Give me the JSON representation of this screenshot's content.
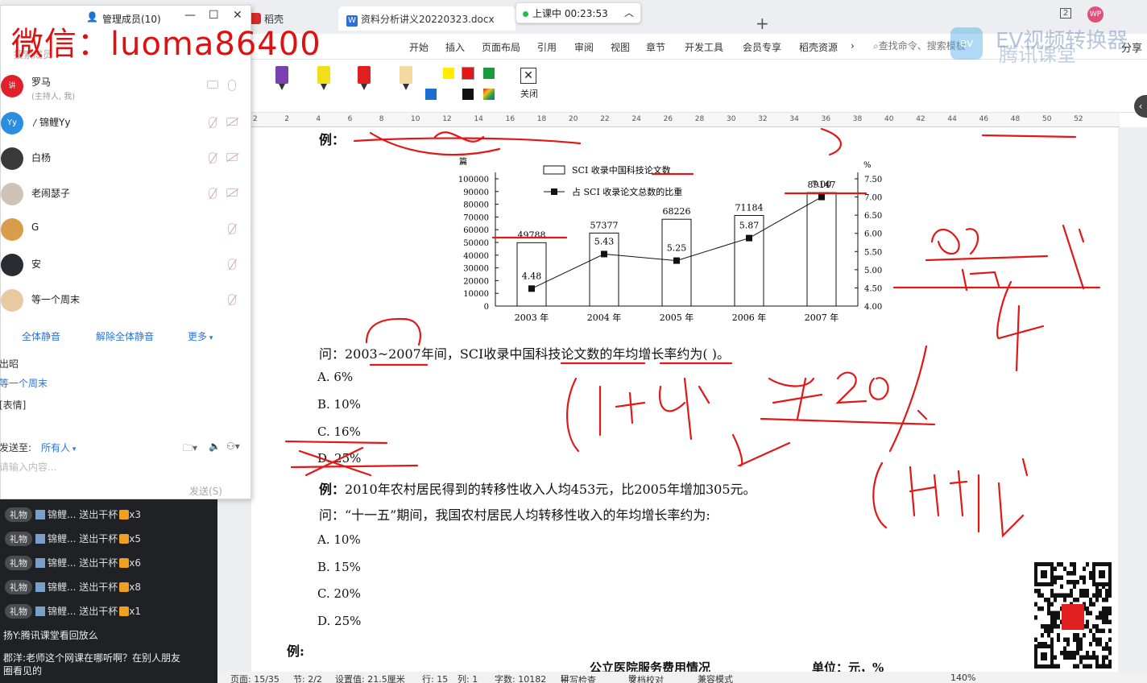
{
  "wps": {
    "tabs": [
      {
        "label": "稻壳"
      },
      {
        "label": "资料分析讲义20220323.docx"
      }
    ],
    "menu": [
      "开始",
      "插入",
      "页面布局",
      "引用",
      "审阅",
      "视图",
      "章节",
      "开发工具",
      "会员专享",
      "稻壳资源"
    ],
    "search_placeholder": "查找命令、搜索模板",
    "share_label": "分享",
    "window_badge": "2",
    "user_initials": "WP",
    "pen_close_label": "关闭",
    "colors": {
      "pens": [
        "#7a3fb0",
        "#f2df1c",
        "#e02020",
        "#f5d9a0"
      ],
      "swatches": [
        "#ffee00",
        "#e01818",
        "#1a9a3a",
        "#1a6fd0",
        "#111111",
        "#c04cc8"
      ]
    },
    "ruler_numbers": [
      "2",
      "2",
      "4",
      "6",
      "8",
      "10",
      "12",
      "14",
      "16",
      "18",
      "20",
      "22",
      "24",
      "26",
      "28",
      "30",
      "32",
      "34",
      "36",
      "38",
      "40",
      "42",
      "44",
      "46",
      "48",
      "50",
      "52"
    ]
  },
  "class_timer": {
    "label": "上课中 00:23:53"
  },
  "member_panel": {
    "title": "管理成员(10)",
    "search_placeholder": "搜索成员",
    "members": [
      {
        "name": "罗马",
        "sub": "(主持人, 我)"
      },
      {
        "name": "锦鲤Yy",
        "sub": ""
      },
      {
        "name": "白杨",
        "sub": ""
      },
      {
        "name": "老闹瑟子",
        "sub": ""
      },
      {
        "name": "G",
        "sub": ""
      },
      {
        "name": "安",
        "sub": ""
      },
      {
        "name": "等一个周末",
        "sub": ""
      }
    ],
    "avatar_texts": {
      "m0": "讲",
      "m1": "Yy"
    },
    "btn_mute_all": "全体静音",
    "btn_unmute_all": "解除全体静音",
    "btn_more": "更多",
    "behind": {
      "line1": "出昭",
      "line2": "等一个周末",
      "line3": "[表情]",
      "send_to_label": "发送至:",
      "send_to_value": "所有人",
      "input_placeholder": "请输入内容...",
      "send_button": "发送(S)"
    }
  },
  "chat": {
    "gift_label": "礼物",
    "gifts": [
      {
        "text": "锦鲤... 送出干杯",
        "count": "x3"
      },
      {
        "text": "锦鲤... 送出干杯",
        "count": "x5"
      },
      {
        "text": "锦鲤... 送出干杯",
        "count": "x6"
      },
      {
        "text": "锦鲤... 送出干杯",
        "count": "x8"
      },
      {
        "text": "锦鲤... 送出干杯",
        "count": "x1"
      }
    ],
    "messages": [
      "扬Y:腾讯课堂看回放么",
      "郡洋:老师这个网课在哪听啊？在别人朋友",
      "圈看见的"
    ]
  },
  "doc": {
    "ex_label": "例：",
    "q1": "问：2003~2007年间，SCI收录中国科技论文数的年均增长率约为(    )。",
    "q1_options": [
      "A. 6%",
      "B. 10%",
      "C. 16%",
      "D. 25%"
    ],
    "ex2": "2010年农村居民得到的转移性收入人均453元，比2005年增加305元。",
    "q2": "问：“十一五”期间，我国农村居民人均转移性收入的年均增长率约为:",
    "q2_options": [
      "A.  10%",
      "B.  15%",
      "C.  20%",
      "D.  25%"
    ],
    "ex3_label": "例:",
    "next_title": "公立医院服务费用情况",
    "next_unit": "单位：元，%"
  },
  "chart_data": {
    "type": "bar",
    "left_axis_unit": "篇",
    "right_axis_unit": "%",
    "categories": [
      "2003 年",
      "2004 年",
      "2005 年",
      "2006 年",
      "2007 年"
    ],
    "series": [
      {
        "name": "SCI 收录中国科技论文数",
        "type": "bar",
        "values": [
          49788,
          57377,
          68226,
          71184,
          89147
        ]
      },
      {
        "name": "占 SCI 收录论文总数的比重",
        "type": "line",
        "axis": "right",
        "values": [
          4.48,
          5.43,
          5.25,
          5.87,
          7.0
        ]
      }
    ],
    "y_left_ticks": [
      "100000",
      "90000",
      "80000",
      "70000",
      "60000",
      "50000",
      "40000",
      "30000",
      "20000",
      "10000",
      "0"
    ],
    "y_left_range": [
      0,
      100000
    ],
    "y_right_ticks": [
      "7.50",
      "7.00",
      "6.50",
      "6.00",
      "5.50",
      "5.00",
      "4.50",
      "4.00"
    ],
    "y_right_range": [
      4.0,
      7.5
    ],
    "legend": "top"
  },
  "status_bar": {
    "page": "页面: 15/35",
    "section": "节: 2/2",
    "setting": "设置值: 21.5厘米",
    "row": "行: 15",
    "col": "列: 1",
    "words": "字数: 10182",
    "spell": "拼写检查",
    "proof": "文档校对",
    "mode": "兼容模式",
    "zoom": "140%"
  },
  "watermarks": {
    "wechat": "微信：luoma86400",
    "ev_text": "EV视频转换器",
    "ev_sub": "腾讯课堂",
    "ev_logo": "ev"
  },
  "ink_notes": [
    "89",
    "50",
    "4年",
    "(1+r)⁴",
    "20%",
    "(1+r)⁴"
  ]
}
